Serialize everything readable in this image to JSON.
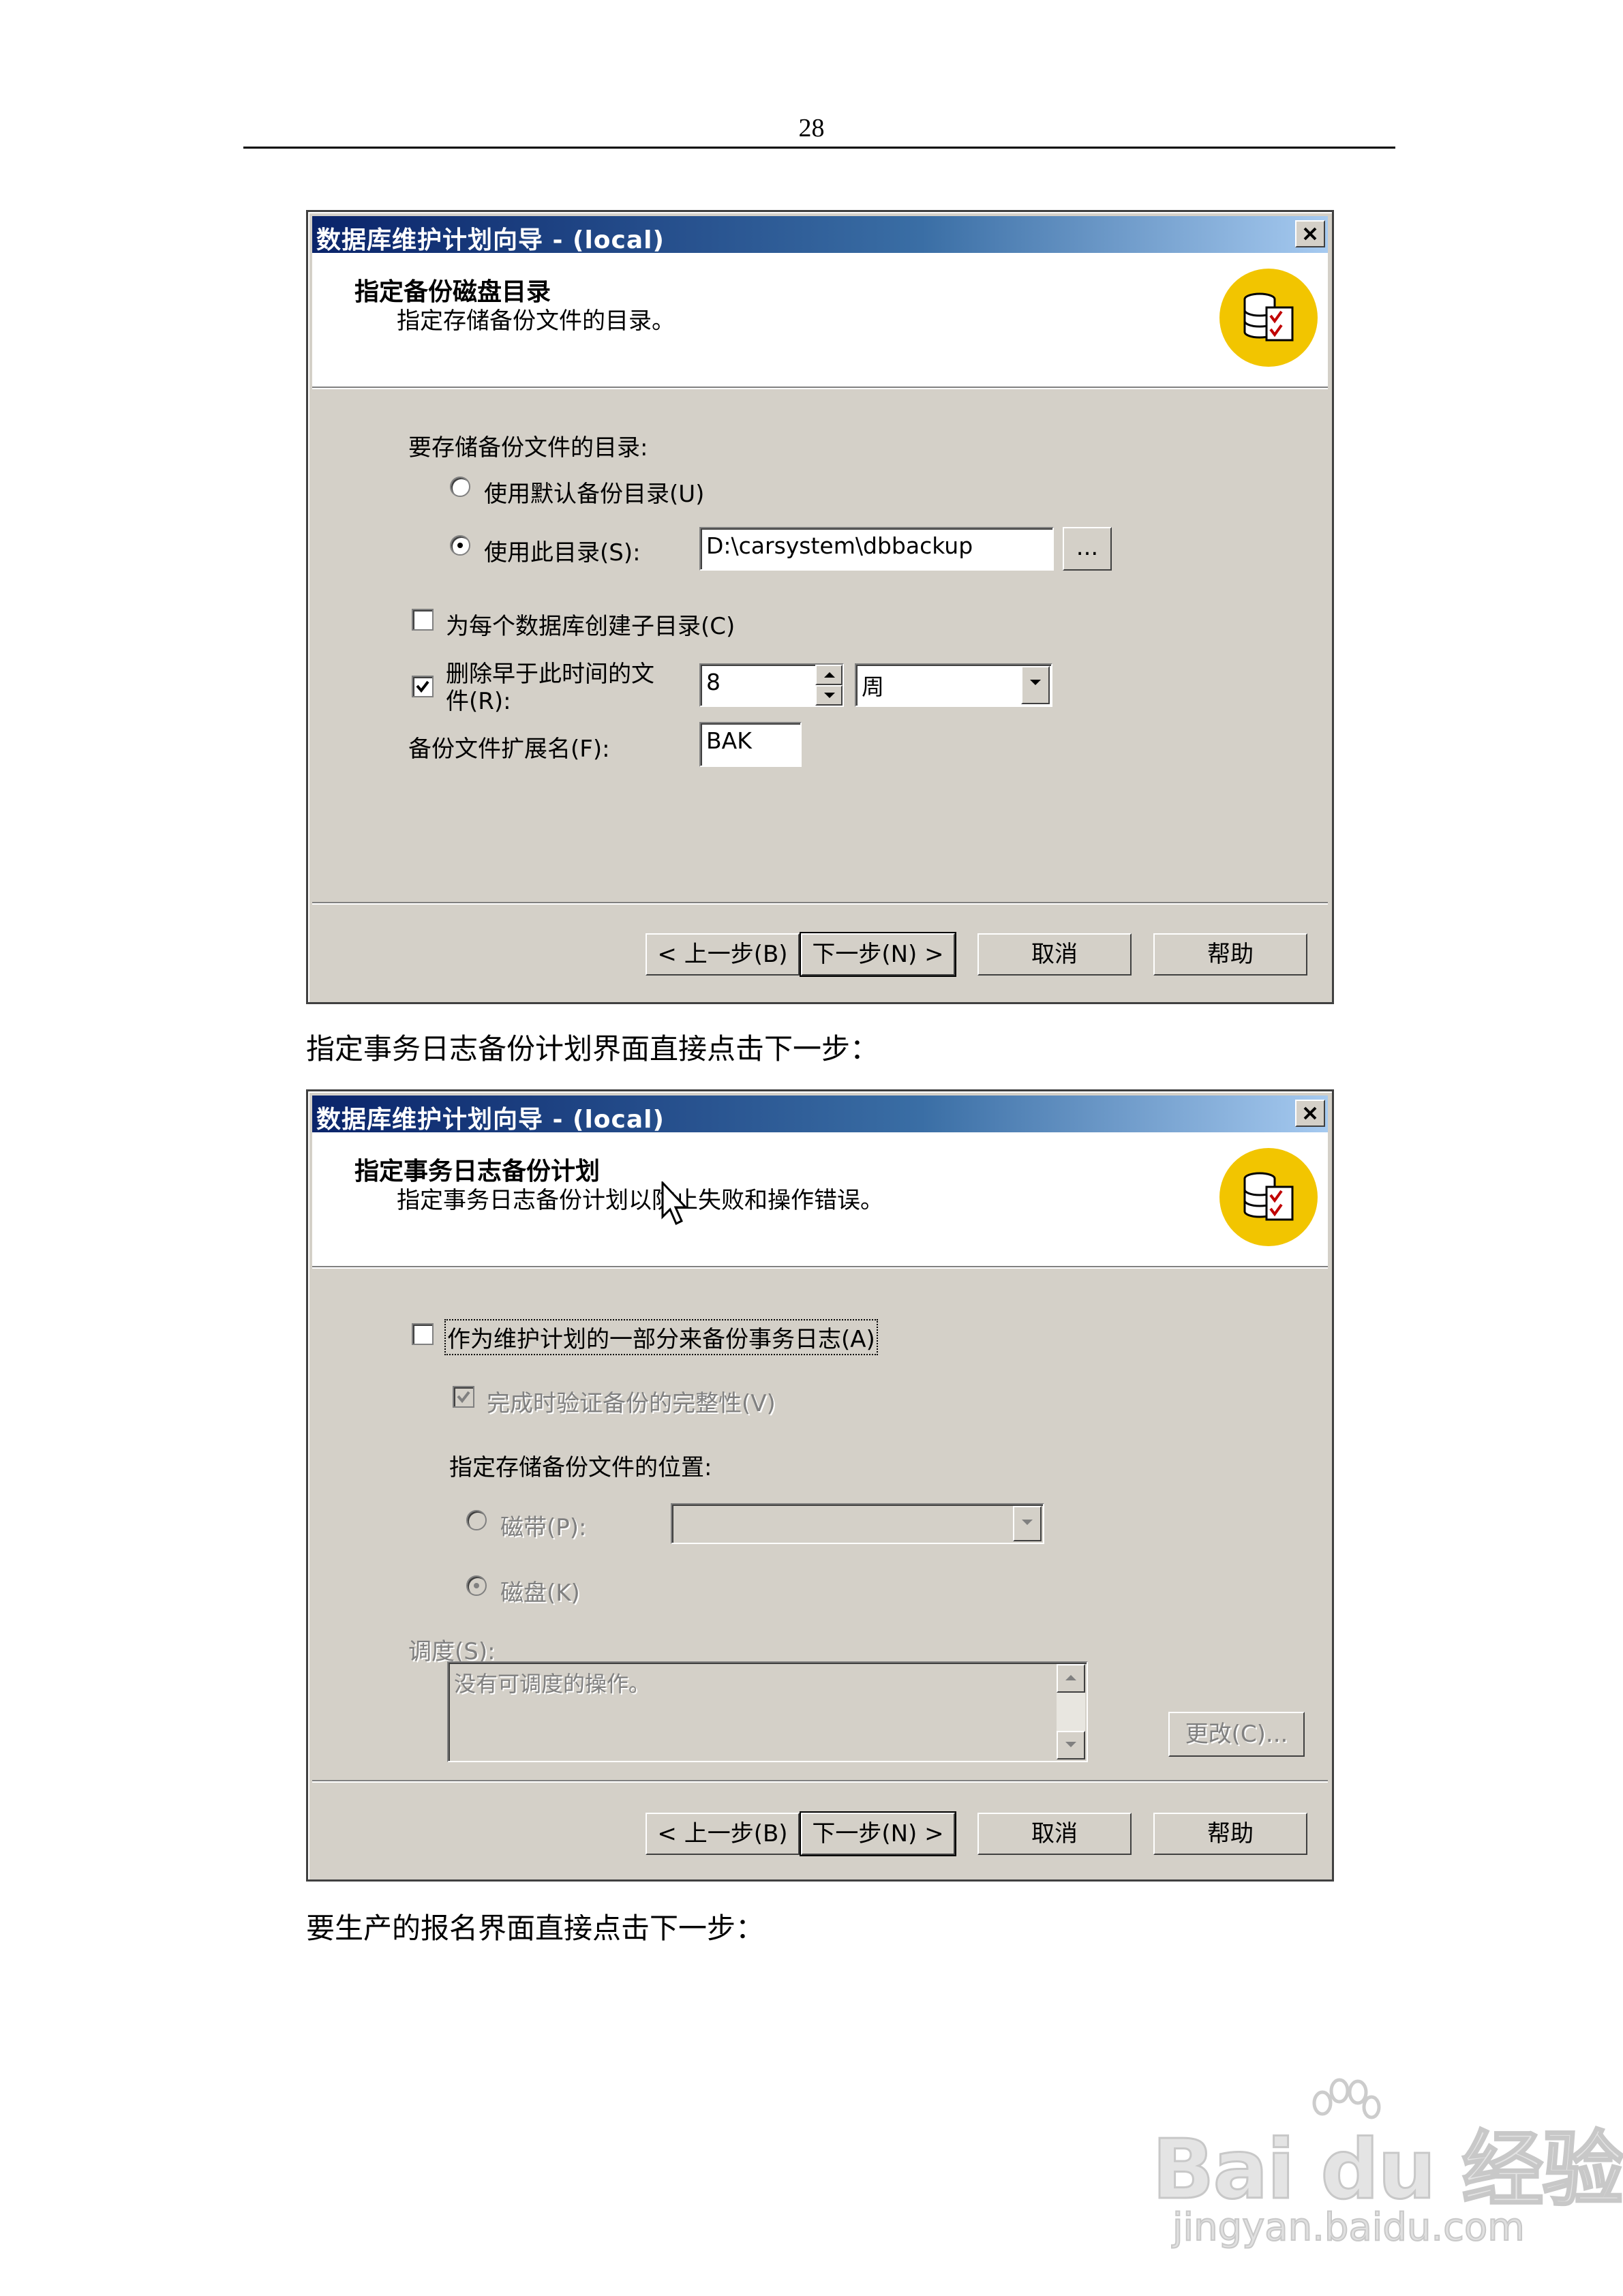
{
  "page": {
    "number": "28",
    "caption1": "指定事务日志备份计划界面直接点击下一步：",
    "caption2": "要生产的报名界面直接点击下一步："
  },
  "dialog1": {
    "title": "数据库维护计划向导 - (local)",
    "header_title": "指定备份磁盘目录",
    "header_subtitle": "指定存储备份文件的目录。",
    "dir_label": "要存储备份文件的目录:",
    "radio_default": "使用默认备份目录(U)",
    "radio_this_dir": "使用此目录(S):",
    "dir_value": "D:\\carsystem\\dbbackup",
    "browse_label": "...",
    "subdir_checkbox": "为每个数据库创建子目录(C)",
    "delete_checkbox_line1": "删除早于此时间的文",
    "delete_checkbox_line2": "件(R):",
    "delete_value": "8",
    "delete_unit": "周",
    "ext_label": "备份文件扩展名(F):",
    "ext_value": "BAK",
    "buttons": {
      "back": "< 上一步(B)",
      "next": "下一步(N) >",
      "cancel": "取消",
      "help": "帮助"
    }
  },
  "dialog2": {
    "title": "数据库维护计划向导 - (local)",
    "header_title": "指定事务日志备份计划",
    "header_subtitle": "指定事务日志备份计划以防止失败和操作错误。",
    "backup_log_checkbox": "作为维护计划的一部分来备份事务日志(A)",
    "verify_checkbox": "完成时验证备份的完整性(V)",
    "location_label": "指定存储备份文件的位置:",
    "radio_tape": "磁带(P):",
    "radio_disk": "磁盘(K)",
    "schedule_label": "调度(S):",
    "schedule_text": "没有可调度的操作。",
    "change_button": "更改(C)...",
    "buttons": {
      "back": "< 上一步(B)",
      "next": "下一步(N) >",
      "cancel": "取消",
      "help": "帮助"
    }
  },
  "watermark": {
    "brand": "Bai du 经验",
    "url": "jingyan.baidu.com"
  },
  "colors": {
    "title_dark": "#0a246a",
    "title_light": "#a6caf0",
    "dialog_face": "#d4d0c8",
    "icon_yellow": "#f2c500"
  }
}
